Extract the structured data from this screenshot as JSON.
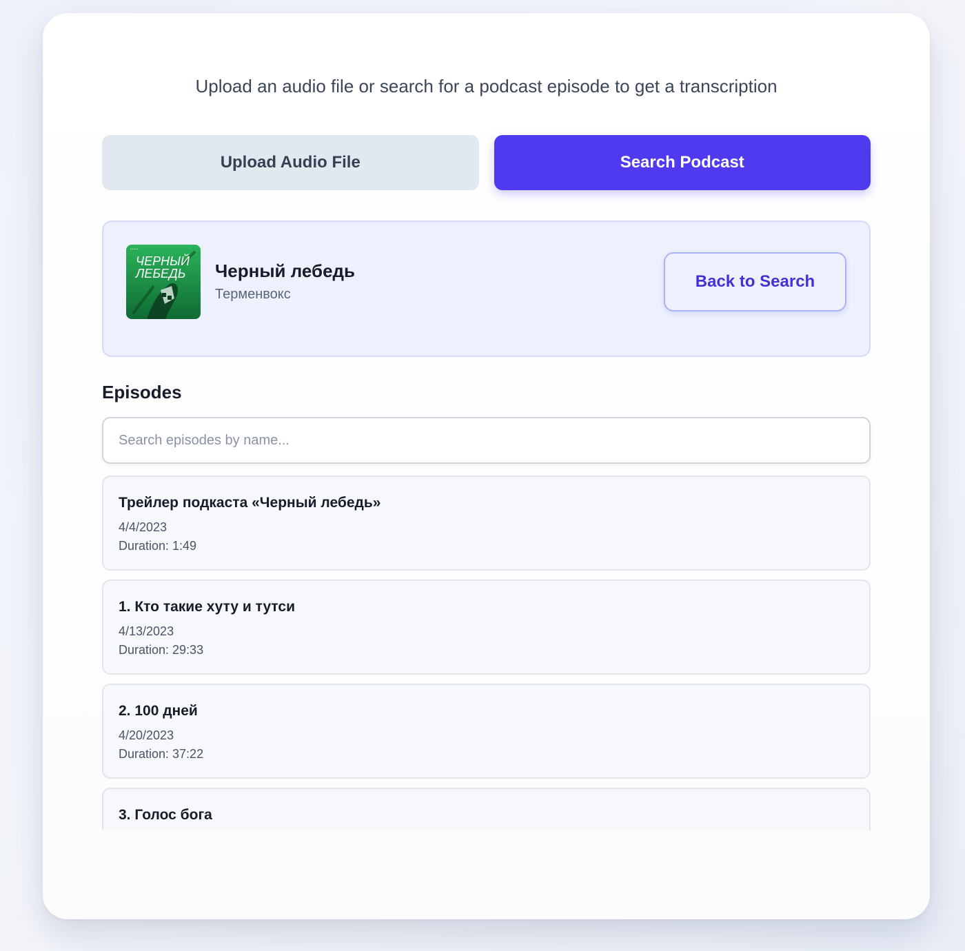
{
  "header": {
    "subtitle": "Upload an audio file or search for a podcast episode to get a transcription"
  },
  "mode_tabs": {
    "upload_label": "Upload Audio File",
    "search_label": "Search Podcast",
    "active": "search"
  },
  "podcast": {
    "title": "Черный лебедь",
    "author": "Терменвокс",
    "cover_text_line1": "ЧЕРНЫЙ",
    "cover_text_line2": "ЛЕБЕДЬ",
    "back_label": "Back to Search"
  },
  "episodes": {
    "heading": "Episodes",
    "search_placeholder": "Search episodes by name...",
    "items": [
      {
        "title": "Трейлер подкаста «Черный лебедь»",
        "date": "4/4/2023",
        "duration": "Duration: 1:49"
      },
      {
        "title": "1. Кто такие хуту и тутси",
        "date": "4/13/2023",
        "duration": "Duration: 29:33"
      },
      {
        "title": "2. 100 дней",
        "date": "4/20/2023",
        "duration": "Duration: 37:22"
      },
      {
        "title": "3. Голос бога",
        "date": "",
        "duration": ""
      }
    ]
  },
  "colors": {
    "accent": "#4f3af0",
    "panel_bg": "#eef1fd",
    "cover_green": "#1f9a4a"
  }
}
